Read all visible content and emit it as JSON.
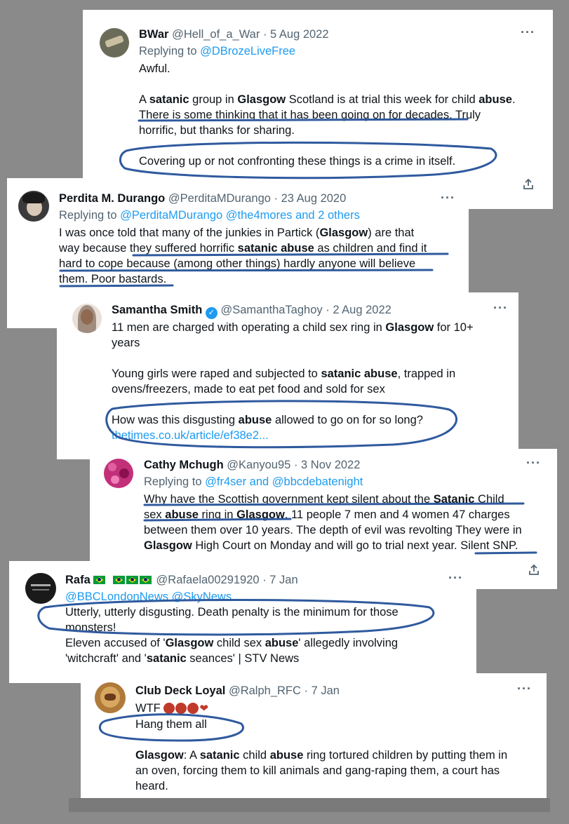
{
  "tweets": [
    {
      "name": "BWar",
      "handle": "@Hell_of_a_War",
      "date": "· 5 Aug 2022",
      "replying_prefix": "Replying to ",
      "replying_to": "@DBrozeLiveFree",
      "avatar_color": "#6b6b5a",
      "lines": {
        "l1": "Awful.",
        "l2a": "A ",
        "l2b": "satanic",
        "l2c": " group in ",
        "l2d": "Glasgow",
        "l2e": " Scotland is at trial this week for child ",
        "l2f": "abuse",
        "l2g": ".",
        "l3": "There is some thinking that it has been going on for decades. Truly",
        "l4": "horrific, but thanks for sharing.",
        "l5": "Covering up or not confronting these things is a crime in itself."
      }
    },
    {
      "name": "Perdita M. Durango",
      "handle": "@PerditaMDurango",
      "date": "· 23 Aug 2020",
      "replying_prefix": "Replying to ",
      "replying_to": "@PerditaMDurango @the4mores  and 2 others",
      "avatar_color": "#3a3a3a",
      "lines": {
        "l1a": "I was once told that many of the junkies in Partick (",
        "l1b": "Glasgow",
        "l1c": ") are that",
        "l2a": "way because they suffered horrific ",
        "l2b": "satanic abuse",
        "l2c": " as children and find it",
        "l3": "hard to cope because (among other things) hardly anyone will believe",
        "l4": "them. Poor bastards."
      }
    },
    {
      "name": "Samantha Smith",
      "verified_glyph": "✓",
      "handle": "@SamanthaTaghoy",
      "date": "· 2 Aug 2022",
      "avatar_color": "#8a6a55",
      "lines": {
        "l1a": "11 men are charged with operating a child sex ring in ",
        "l1b": "Glasgow",
        "l1c": " for 10+",
        "l2": "years",
        "l3a": "Young girls were raped and subjected to ",
        "l3b": "satanic abuse",
        "l3c": ", trapped in",
        "l4": "ovens/freezers, made to eat pet food and sold for sex",
        "l5a": "How was this disgusting ",
        "l5b": "abuse",
        "l5c": " allowed to go on for so long?",
        "l6": "thetimes.co.uk/article/ef38e2..."
      }
    },
    {
      "name": "Cathy Mchugh",
      "handle": "@Kanyou95",
      "date": "· 3 Nov 2022",
      "replying_prefix": "Replying to ",
      "replying_to": "@fr4ser and @bbcdebatenight",
      "avatar_color": "#c2307a",
      "lines": {
        "l1a": "Why have the Scottish government kept silent about the ",
        "l1b": "Satanic",
        "l1c": " Child",
        "l2a": "sex ",
        "l2b": "abuse",
        "l2c": " ring in ",
        "l2d": "Glasgow",
        "l2e": ". 11 people 7 men and 4 women 47 charges",
        "l3": "between them over 10 years. The depth of evil was revolting They were in",
        "l4a": "Glasgow",
        "l4b": " High Court on Monday and will go to trial next year. Silent SNP."
      }
    },
    {
      "name": "Rafa",
      "handle": "@Rafaela00291920",
      "date": "· 7 Jan",
      "replying_to": "@BBCLondonNews @SkyNews",
      "avatar_color": "#1a1a1a",
      "lines": {
        "l1": "Utterly, utterly disgusting. Death penalty is the minimum for those",
        "l2": "monsters!",
        "l3a": "Eleven accused of '",
        "l3b": "Glasgow",
        "l3c": " child sex ",
        "l3d": "abuse",
        "l3e": "' allegedly involving",
        "l4a": "'witchcraft' and '",
        "l4b": "satanic",
        "l4c": " seances' | STV News"
      }
    },
    {
      "name": "Club Deck Loyal",
      "handle": "@Ralph_RFC",
      "date": "· 7 Jan",
      "avatar_color": "#b07a3a",
      "lines": {
        "l1": "WTF",
        "l2": "Hang them all",
        "l3a": "Glasgow",
        "l3b": ": A ",
        "l3c": "satanic",
        "l3d": " child ",
        "l3e": "abuse",
        "l3f": " ring tortured children by putting them in",
        "l4": "an oven, forcing them to kill animals and gang-raping them, a court has",
        "l5": "heard."
      }
    }
  ],
  "more_glyph": "···",
  "share_icon": "share-icon",
  "colors": {
    "link": "#1d9bf0",
    "annotation": "#2f5a9e",
    "muted": "#536471",
    "background": "#8a8a8a"
  }
}
